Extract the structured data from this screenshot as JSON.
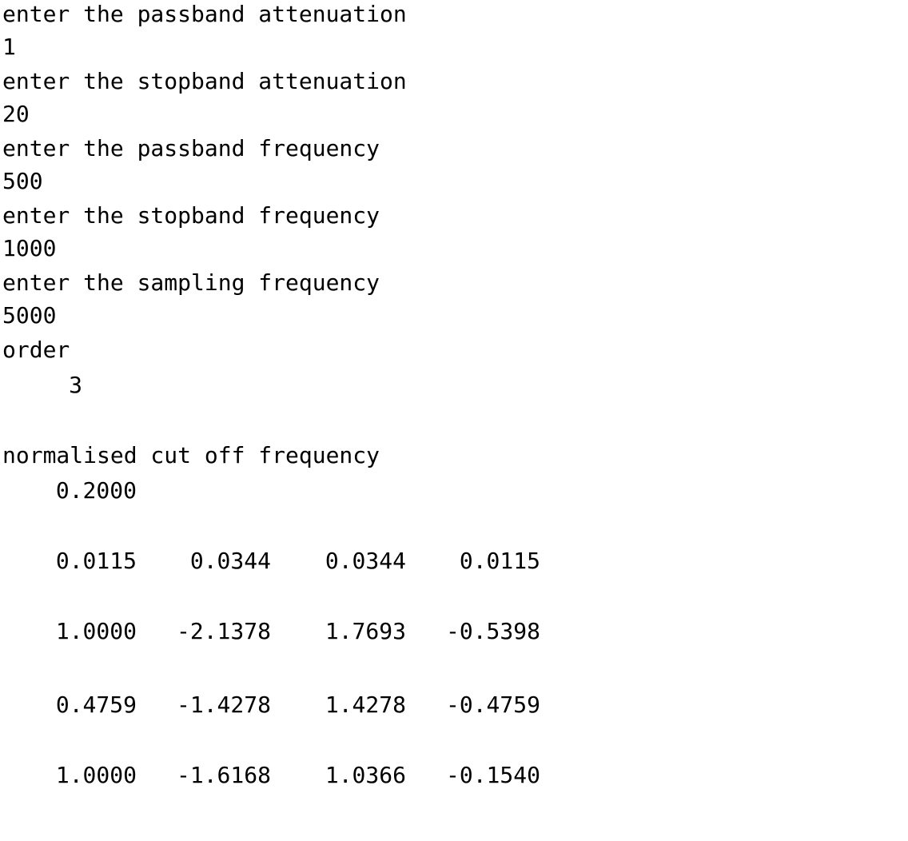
{
  "prompts": [
    {
      "prompt": "enter the passband attenuation",
      "value": "1"
    },
    {
      "prompt": "enter the stopband attenuation",
      "value": "20"
    },
    {
      "prompt": "enter the passband frequency",
      "value": "500"
    },
    {
      "prompt": "enter the stopband frequency",
      "value": "1000"
    },
    {
      "prompt": "enter the sampling frequency",
      "value": "5000"
    }
  ],
  "order": {
    "label": "order",
    "value": "3"
  },
  "cutoff": {
    "label": "normalised cut off frequency",
    "value": "0.2000"
  },
  "rows": [
    [
      "0.0115",
      "0.0344",
      "0.0344",
      "0.0115"
    ],
    [
      "1.0000",
      "-2.1378",
      "1.7693",
      "-0.5398"
    ],
    [
      "0.4759",
      "-1.4278",
      "1.4278",
      "-0.4759"
    ],
    [
      "1.0000",
      "-1.6168",
      "1.0366",
      "-0.1540"
    ]
  ]
}
